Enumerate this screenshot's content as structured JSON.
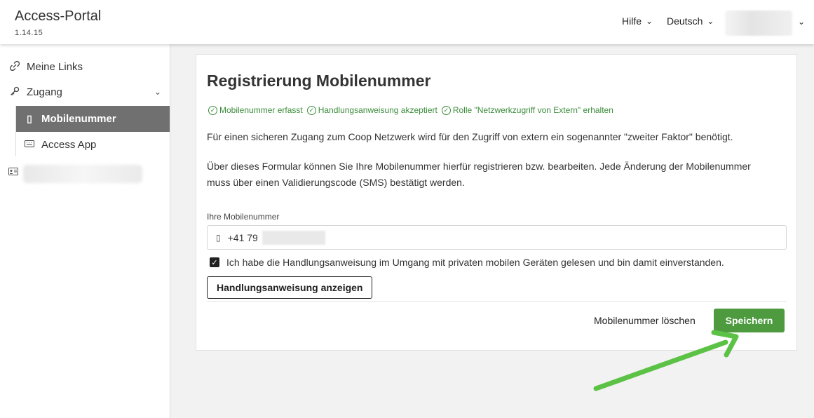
{
  "header": {
    "app_title": "Access-Portal",
    "version": "1.14.15",
    "help_label": "Hilfe",
    "language_label": "Deutsch"
  },
  "sidebar": {
    "items": [
      {
        "label": "Meine Links",
        "icon": "link-icon"
      },
      {
        "label": "Zugang",
        "icon": "key-icon"
      },
      {
        "label": "Mobilenummer",
        "icon": "phone-icon"
      },
      {
        "label": "Access App",
        "icon": "keyboard-icon"
      }
    ]
  },
  "main": {
    "title": "Registrierung Mobilenummer",
    "statuses": [
      "Mobilenummer erfasst",
      "Handlungsanweisung akzeptiert",
      "Rolle \"Netzwerkzugriff von Extern\" erhalten"
    ],
    "intro": "Für einen sicheren Zugang zum Coop Netzwerk wird für den Zugriff von extern ein sogenannter \"zweiter Faktor\" benötigt.",
    "description": "Über dieses Formular können Sie Ihre Mobilenummer hierfür registrieren bzw. bearbeiten. Jede Änderung der Mobilenummer muss über einen Validierungscode (SMS) bestätigt werden.",
    "field_label": "Ihre Mobilenummer",
    "phone_prefix": "+41 79",
    "checkbox_label": "Ich habe die Handlungsanweisung im Umgang mit privaten mobilen Geräten gelesen und bin damit einverstanden.",
    "checkbox_checked": true,
    "show_instructions_button": "Handlungsanweisung anzeigen",
    "delete_link": "Mobilenummer löschen",
    "save_button": "Speichern"
  },
  "colors": {
    "accent_green": "#4d9a3f",
    "status_green": "#3b8c3b",
    "active_nav": "#707070",
    "arrow_green": "#5cc246"
  }
}
